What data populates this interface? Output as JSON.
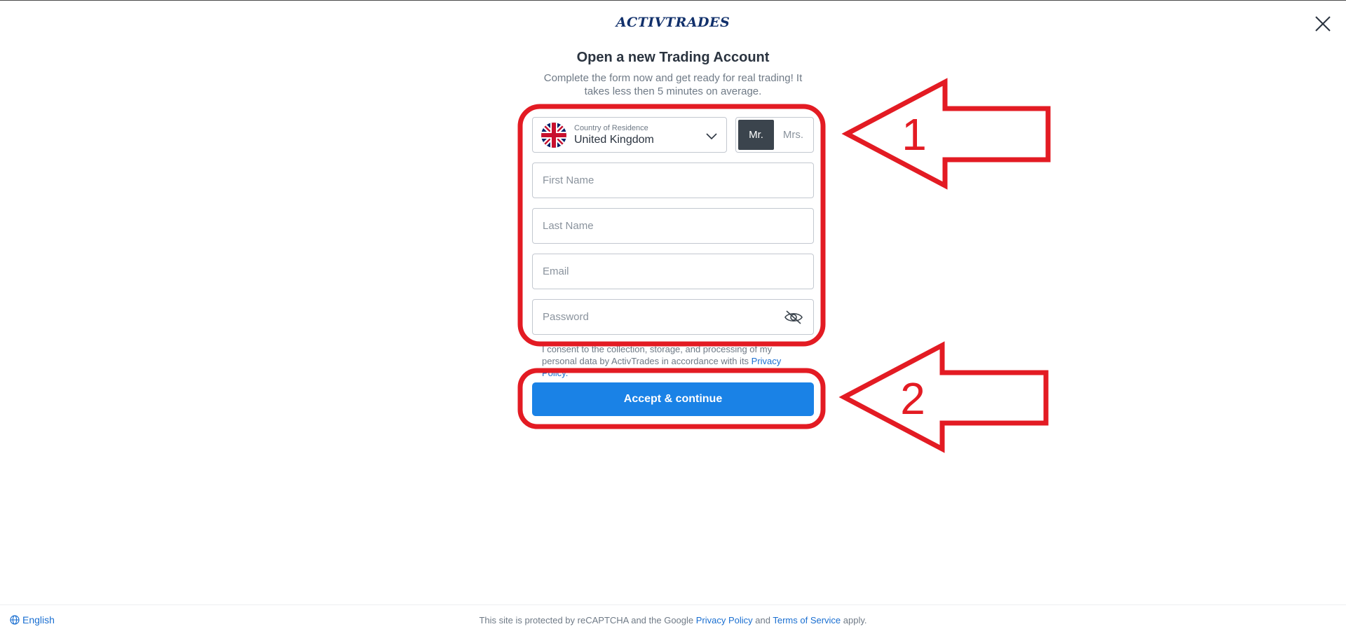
{
  "header": {
    "logo_text": "ACTIVTRADES"
  },
  "form": {
    "title": "Open a new Trading Account",
    "subtitle": "Complete the form now and get ready for real trading! It takes less then 5 minutes on average.",
    "country": {
      "label": "Country of Residence",
      "value": "United Kingdom",
      "flag": "uk-flag"
    },
    "salutation": {
      "options": [
        "Mr.",
        "Mrs."
      ],
      "selected": "Mr."
    },
    "first_name": {
      "placeholder": "First Name",
      "value": ""
    },
    "last_name": {
      "placeholder": "Last Name",
      "value": ""
    },
    "email": {
      "placeholder": "Email",
      "value": ""
    },
    "password": {
      "placeholder": "Password",
      "value": ""
    },
    "consent": {
      "text": "I consent to the collection, storage, and processing of my personal data by ActivTrades in accordance with its ",
      "link": "Privacy Policy."
    },
    "submit_label": "Accept & continue"
  },
  "annotations": {
    "label_1": "1",
    "label_2": "2",
    "color": "#e31b23"
  },
  "footer": {
    "language": "English",
    "recaptcha_prefix": "This site is protected by reCAPTCHA and the Google ",
    "privacy_link": "Privacy Policy",
    "and_text": " and ",
    "terms_link": "Terms of Service",
    "suffix": " apply."
  },
  "colors": {
    "primary": "#1a82e6",
    "logo": "#11306b",
    "toggle_active": "#3b444d"
  }
}
